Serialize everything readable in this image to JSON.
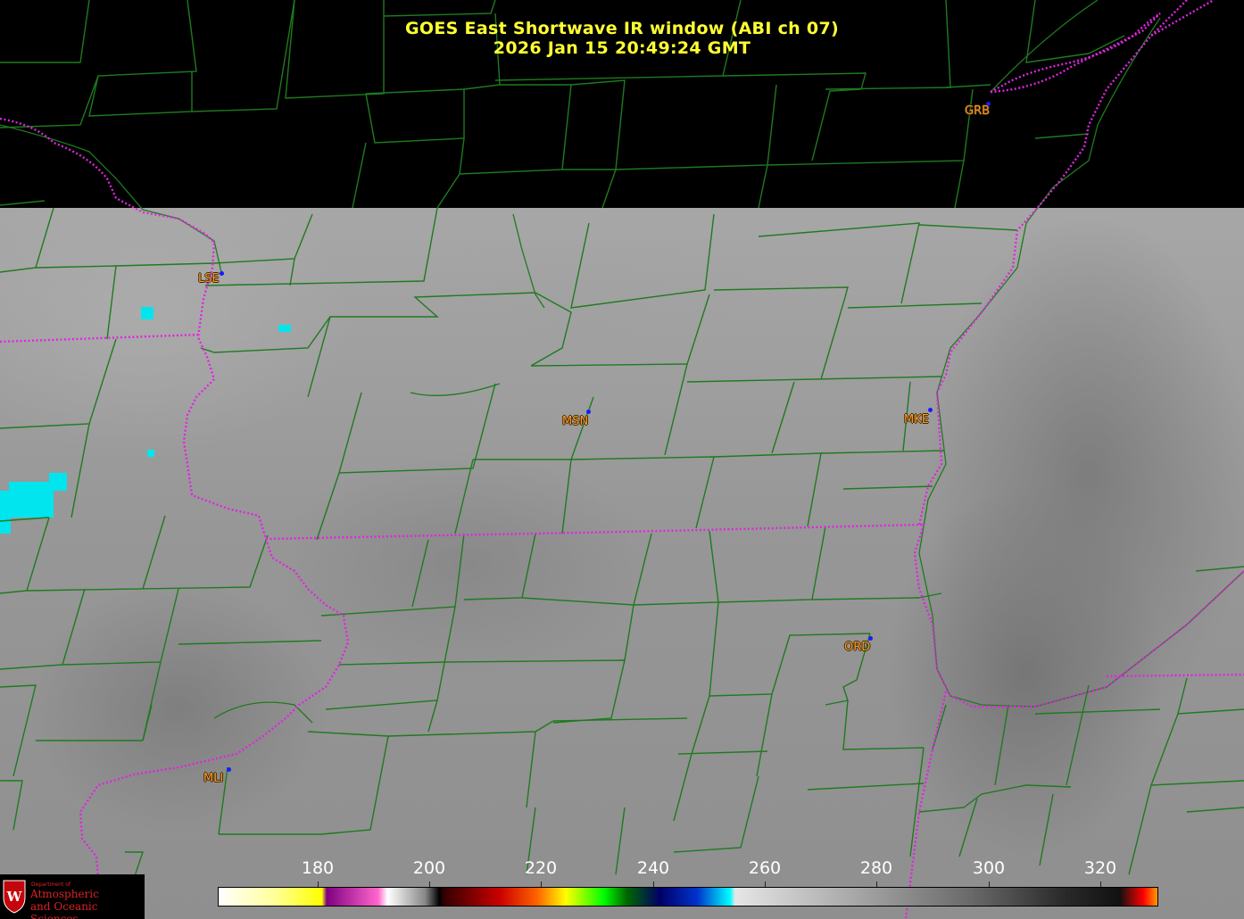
{
  "header": {
    "title": "GOES East Shortwave IR window (ABI ch 07)",
    "timestamp": "2026 Jan 15  20:49:24 GMT"
  },
  "stations": [
    {
      "id": "GRB"
    },
    {
      "id": "LSE"
    },
    {
      "id": "MSN"
    },
    {
      "id": "MKE"
    },
    {
      "id": "ORD"
    },
    {
      "id": "MLI"
    }
  ],
  "colorbar": {
    "ticks": [
      "180",
      "200",
      "220",
      "240",
      "260",
      "280",
      "300",
      "320"
    ]
  },
  "logo": {
    "dept": "Department of",
    "line1": "Atmospheric",
    "line2": "and Oceanic Sciences"
  },
  "colors": {
    "title": "#ffff33",
    "station_label": "#ff9933",
    "county_lines": "#1f7a1f",
    "state_lines": "#e024e0",
    "station_dot": "#1a1aff"
  }
}
